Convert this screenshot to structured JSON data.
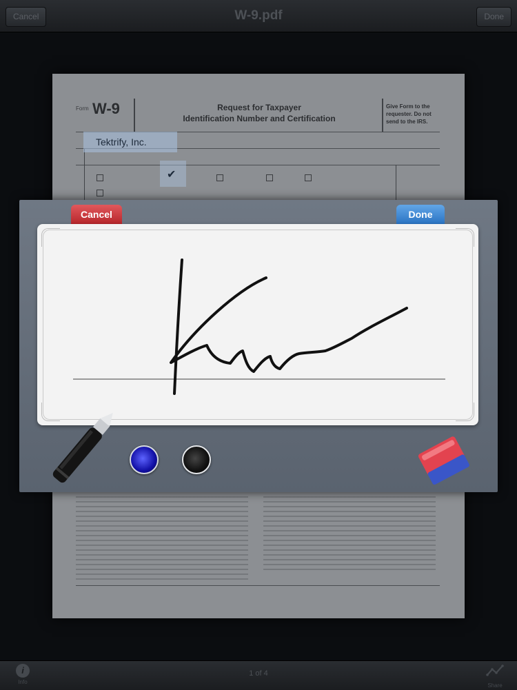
{
  "topbar": {
    "title": "W-9.pdf",
    "cancel_label": "Cancel",
    "done_label": "Done"
  },
  "document": {
    "form_prefix": "Form",
    "form_number": "W-9",
    "heading_line1": "Request for Taxpayer",
    "heading_line2": "Identification Number and Certification",
    "sidenote": "Give Form to the requester. Do not send to the IRS.",
    "name_field_value": "Tektrify, Inc."
  },
  "signature_panel": {
    "cancel_label": "Cancel",
    "done_label": "Done",
    "ink_colors": {
      "blue": "#1a1ad0",
      "black": "#111111"
    },
    "cancel_color": "#c9353a",
    "done_color": "#3f87d3"
  },
  "bottombar": {
    "page_indicator": "1 of 4",
    "info_label": "Info",
    "share_label": "Share"
  },
  "icons": {
    "info": "info-icon",
    "share": "share-icon",
    "pen": "pen-icon",
    "eraser": "eraser-icon"
  }
}
